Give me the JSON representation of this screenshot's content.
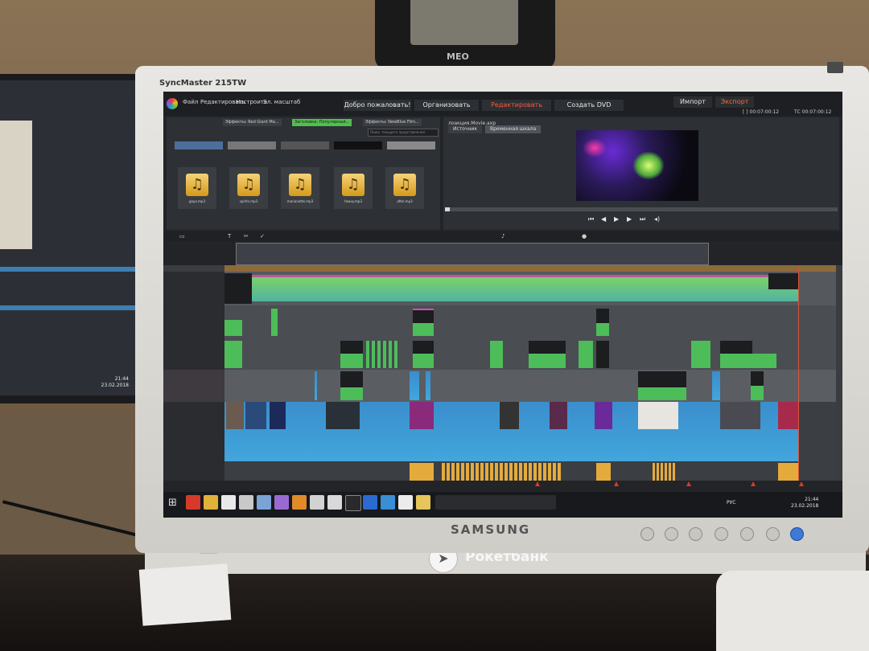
{
  "station": {
    "brand": "MEO"
  },
  "monitor": {
    "model": "SyncMaster 215TW",
    "brand": "SAMSUNG"
  },
  "sticker": {
    "brand": "Рокетбанк"
  },
  "left_monitor": {
    "clock": "21:44",
    "date": "23.02.2018"
  },
  "app": {
    "menu": [
      "Файл",
      "Редактировать",
      "Настроить",
      "Эл. масштаб"
    ],
    "tabs": [
      "Добро пожаловать!",
      "Организовать",
      "Редактировать",
      "Создать DVD"
    ],
    "import_label": "Импорт",
    "export_label": "Экспорт",
    "timecode1": "[ ] 00:07:00:12",
    "timecode2": "ТС 00:07:00:12"
  },
  "library": {
    "tabs": [
      "Эффекты: Red Giant Ma...",
      "Заголовки: Популярный...",
      "Эффекты: NewBlue Film..."
    ],
    "search_placeholder": "Поиск текущего представления",
    "audio_items": [
      "gayo.mp3",
      "spirits.mp3",
      "marionette.mp3",
      "heavy.mp3",
      "after.mp3"
    ]
  },
  "player": {
    "title": "лоакция.Movie.axp",
    "tabs": [
      "Источник",
      "Временная шкала"
    ]
  },
  "taskbar": {
    "lang": "РУС",
    "clock": "21:44",
    "date": "23.02.2018"
  },
  "colors": {
    "accent": "#ff5a36",
    "clip_green": "#5bbf5b",
    "clip_blue": "#3a8ecc",
    "clip_orange": "#e4ab3c"
  }
}
